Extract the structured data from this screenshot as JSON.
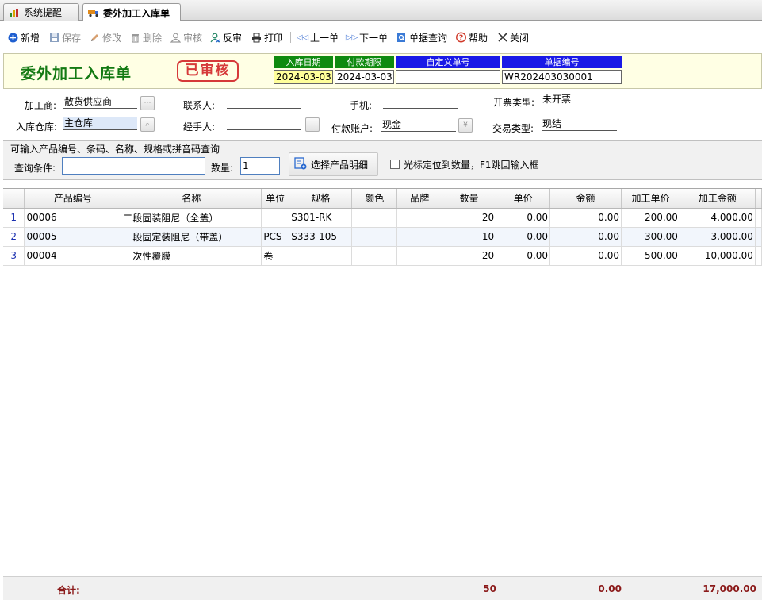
{
  "tabs": [
    {
      "label": "系统提醒",
      "icon": "chart-icon"
    },
    {
      "label": "委外加工入库单",
      "icon": "truck-icon"
    }
  ],
  "toolbar": {
    "new": "新增",
    "save": "保存",
    "edit": "修改",
    "delete": "删除",
    "audit": "审核",
    "unaudit": "反审",
    "print": "打印",
    "prev": "上一单",
    "next": "下一单",
    "query": "单据查询",
    "help": "帮助",
    "close": "关闭"
  },
  "header": {
    "title": "委外加工入库单",
    "stamp": "已审核",
    "date_label": "入库日期",
    "date_value": "2024-03-03",
    "due_label": "付款期限",
    "due_value": "2024-03-03",
    "custom_label": "自定义单号",
    "custom_value": "",
    "no_label": "单据编号",
    "no_value": "WR202403030001"
  },
  "form": {
    "processor_label": "加工商:",
    "processor_value": "散货供应商",
    "contact_label": "联系人:",
    "contact_value": "",
    "mobile_label": "手机:",
    "mobile_value": "",
    "invoice_label": "开票类型:",
    "invoice_value": "未开票",
    "warehouse_label": "入库仓库:",
    "warehouse_value": "主仓库",
    "handler_label": "经手人:",
    "handler_value": "",
    "account_label": "付款账户:",
    "account_value": "现金",
    "trade_label": "交易类型:",
    "trade_value": "现结"
  },
  "query": {
    "title": "可输入产品编号、条码、名称、规格或拼音码查询",
    "cond_label": "查询条件:",
    "cond_value": "",
    "qty_label": "数量:",
    "qty_value": "1",
    "pick_button": "选择产品明细",
    "cursor_option": "光标定位到数量，F1跳回输入框"
  },
  "grid": {
    "columns": [
      "产品编号",
      "名称",
      "单位",
      "规格",
      "颜色",
      "品牌",
      "数量",
      "单价",
      "金额",
      "加工单价",
      "加工金额"
    ],
    "rows": [
      {
        "n": "1",
        "code": "00006",
        "name": "二段固装阻尼（全盖）",
        "unit": "",
        "spec": "S301-RK",
        "color": "",
        "brand": "",
        "qty": "20",
        "price": "0.00",
        "amount": "0.00",
        "pprice": "200.00",
        "pamount": "4,000.00"
      },
      {
        "n": "2",
        "code": "00005",
        "name": "一段固定装阻尼（带盖）",
        "unit": "PCS",
        "spec": "S333-105",
        "color": "",
        "brand": "",
        "qty": "10",
        "price": "0.00",
        "amount": "0.00",
        "pprice": "300.00",
        "pamount": "3,000.00"
      },
      {
        "n": "3",
        "code": "00004",
        "name": "一次性覆膜",
        "unit": "卷",
        "spec": "",
        "color": "",
        "brand": "",
        "qty": "20",
        "price": "0.00",
        "amount": "0.00",
        "pprice": "500.00",
        "pamount": "10,000.00"
      }
    ]
  },
  "footer": {
    "label": "合计:",
    "qty": "50",
    "amount": "0.00",
    "pamount": "17,000.00"
  }
}
